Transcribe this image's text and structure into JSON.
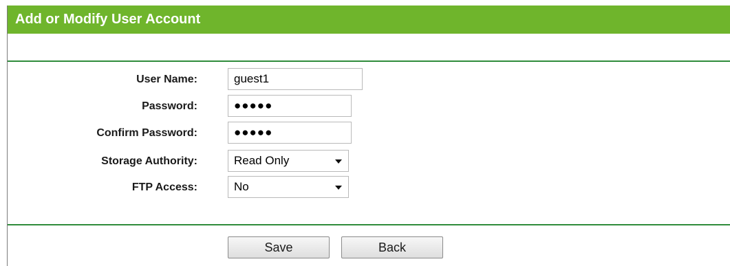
{
  "header": {
    "title": "Add or Modify User Account"
  },
  "form": {
    "user_name": {
      "label": "User Name:",
      "value": "guest1"
    },
    "password": {
      "label": "Password:",
      "value": "●●●●●"
    },
    "confirm_password": {
      "label": "Confirm Password:",
      "value": "●●●●●"
    },
    "storage_authority": {
      "label": "Storage Authority:",
      "value": "Read Only"
    },
    "ftp_access": {
      "label": "FTP Access:",
      "value": "No"
    }
  },
  "buttons": {
    "save": "Save",
    "back": "Back"
  },
  "colors": {
    "header_bg": "#6fb52c",
    "divider": "#2e8b3a"
  },
  "icons": {
    "dropdown": "chevron-down-icon"
  }
}
